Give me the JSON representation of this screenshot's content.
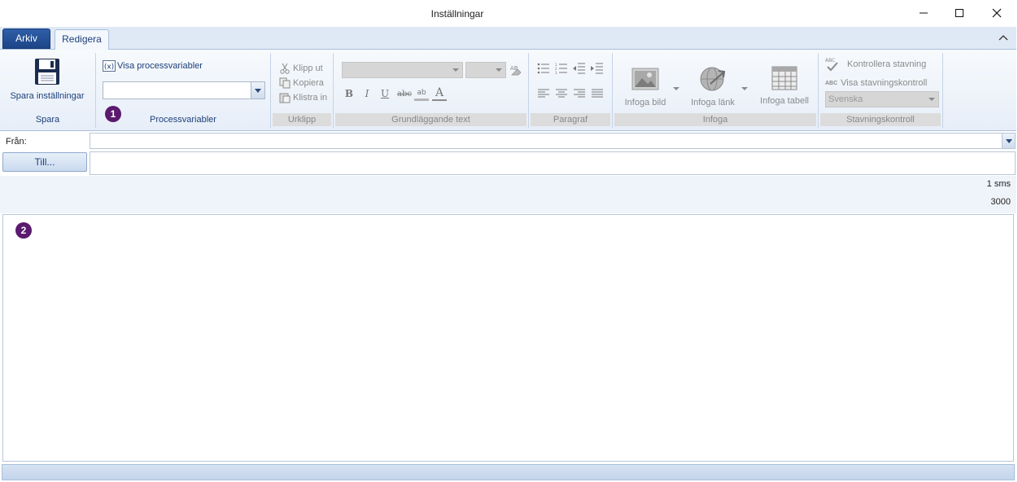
{
  "window": {
    "title": "Inställningar"
  },
  "tabs": [
    {
      "label": "Arkiv",
      "active": false
    },
    {
      "label": "Redigera",
      "active": true
    }
  ],
  "ribbon": {
    "spara": {
      "button_label": "Spara inställningar",
      "group_label": "Spara"
    },
    "processvariabler": {
      "link_label": "Visa processvariabler",
      "combo_value": "",
      "group_label": "Processvariabler"
    },
    "urklipp": {
      "cut_label": "Klipp ut",
      "copy_label": "Kopiera",
      "paste_label": "Klistra in",
      "group_label": "Urklipp"
    },
    "grundlaggande_text": {
      "font_value": "",
      "size_value": "",
      "format_buttons": [
        "B",
        "I",
        "U",
        "abc",
        "ab",
        "A"
      ],
      "group_label": "Grundläggande text"
    },
    "paragraf": {
      "group_label": "Paragraf"
    },
    "infoga": {
      "image_label": "Infoga bild",
      "link_label": "Infoga länk",
      "table_label": "Infoga tabell",
      "group_label": "Infoga"
    },
    "stavning": {
      "check_label": "Kontrollera stavning",
      "show_label": "Visa stavningskontroll",
      "language_value": "Svenska",
      "group_label": "Stavningskontroll",
      "abc": "ABC"
    }
  },
  "form": {
    "from_label": "Från:",
    "from_value": "",
    "to_button_label": "Till...",
    "to_value": "",
    "sms_count": "1 sms",
    "char_count": "3000",
    "body_value": ""
  },
  "badges": {
    "one": "1",
    "two": "2"
  },
  "colors": {
    "accent": "#1c3f7a",
    "arkiv_tab": "#1c4587",
    "ribbon_bg": "#e7eef8",
    "badge": "#5a1a6e"
  }
}
